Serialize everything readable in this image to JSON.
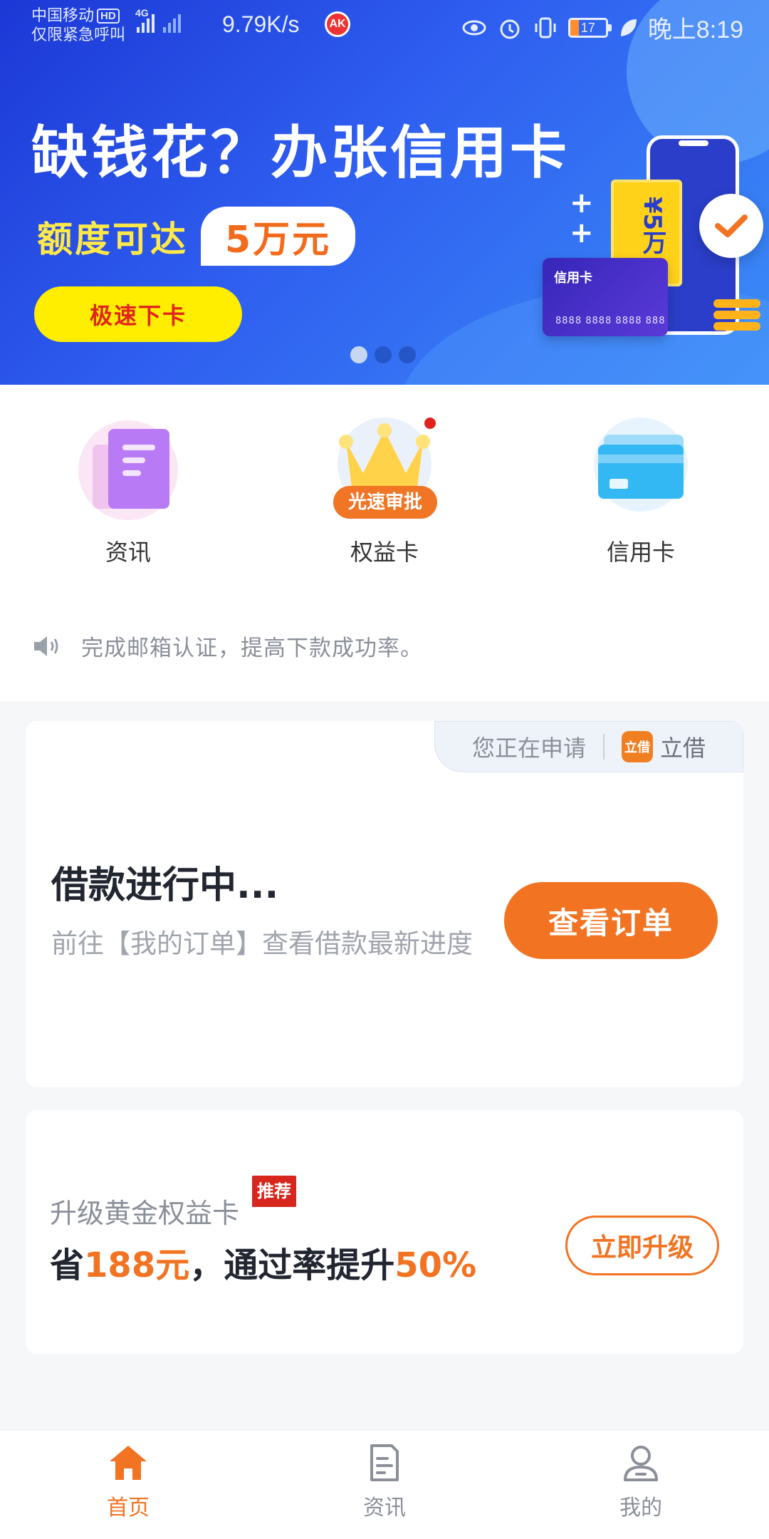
{
  "status_bar": {
    "carrier_line1": "中国移动",
    "hd": "HD",
    "carrier_line2": "仅限紧急呼叫",
    "network_type": "4G",
    "net_speed": "9.79K/s",
    "battery": "17",
    "time": "晚上8:19"
  },
  "banner": {
    "title": "缺钱花？办张信用卡",
    "subtitle_label": "额度可达",
    "subtitle_amount": "5万元",
    "cta": "极速下卡",
    "card_title": "信用卡",
    "card_number": "8888 8888 8888 888",
    "ticket_text": "¥5万",
    "page_count": 3,
    "active_page": 1,
    "colors": {
      "gradient_start": "#1c38d6",
      "gradient_end": "#3b8cf7",
      "cta_bg": "#ffee00",
      "cta_text": "#e0251d"
    }
  },
  "quick_menu": {
    "items": [
      {
        "label": "资讯",
        "icon": "document-icon"
      },
      {
        "label": "权益卡",
        "icon": "crown-icon",
        "badge": "光速审批",
        "has_red_dot": true
      },
      {
        "label": "信用卡",
        "icon": "credit-card-icon"
      }
    ]
  },
  "notice": {
    "icon": "speaker-icon",
    "text": "完成邮箱认证，提高下款成功率。"
  },
  "loan_card": {
    "applying_label": "您正在申请",
    "app_logo_text": "立借",
    "app_name": "立借",
    "title": "借款进行中...",
    "subtitle": "前往【我的订单】查看借款最新进度",
    "button": "查看订单"
  },
  "upgrade_card": {
    "label": "升级黄金权益卡",
    "badge": "推荐",
    "main_prefix": "省",
    "main_amount": "188元",
    "main_middle": "，通过率提升",
    "main_rate": "50%",
    "button": "立即升级",
    "accent_color": "#f27321"
  },
  "bottom_nav": {
    "items": [
      {
        "label": "首页",
        "icon": "home-icon",
        "active": true
      },
      {
        "label": "资讯",
        "icon": "news-icon",
        "active": false
      },
      {
        "label": "我的",
        "icon": "profile-icon",
        "active": false
      }
    ]
  }
}
